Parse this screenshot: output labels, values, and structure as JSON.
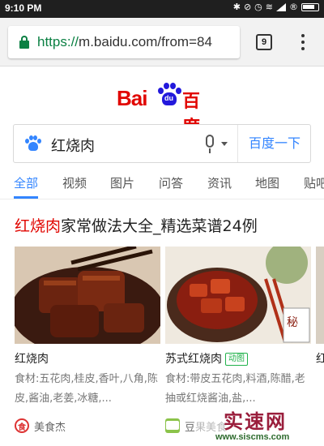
{
  "status_bar": {
    "time": "9:10 PM",
    "icons": [
      "bluetooth-icon",
      "mute-icon",
      "alarm-icon",
      "wifi-icon",
      "signal-icon",
      "battery-icon"
    ]
  },
  "browser": {
    "url_scheme": "https://",
    "url_rest": "m.baidu.com/from=84",
    "tab_count": "9"
  },
  "logo": {
    "latin": "Bai",
    "paw_text": "du",
    "chinese": "百度"
  },
  "search": {
    "query": "红烧肉",
    "submit_label": "百度一下"
  },
  "nav_tabs": [
    {
      "label": "全部",
      "active": true
    },
    {
      "label": "视频",
      "active": false
    },
    {
      "label": "图片",
      "active": false
    },
    {
      "label": "问答",
      "active": false
    },
    {
      "label": "资讯",
      "active": false
    },
    {
      "label": "地图",
      "active": false
    },
    {
      "label": "贴吧",
      "active": false
    }
  ],
  "result": {
    "title_highlight": "红烧肉",
    "title_rest": "家常做法大全_精选菜谱24例"
  },
  "cards": [
    {
      "name": "红烧肉",
      "badge": "",
      "desc": "食材:五花肉,桂皮,香叶,八角,陈皮,酱油,老姜,冰糖,...",
      "source": "美食杰"
    },
    {
      "name": "苏式红烧肉",
      "badge": "动图",
      "desc": "食材:带皮五花肉,料酒,陈醋,老抽或红烧酱油,盐,...",
      "source": "豆果美食"
    },
    {
      "name": "红"
    }
  ],
  "watermark": {
    "big": "实速网",
    "small": "www.siscms.com"
  },
  "colors": {
    "baidu_red": "#e10601",
    "baidu_blue": "#2319dc",
    "accent_blue": "#3385ff",
    "secure_green": "#0b8043"
  }
}
